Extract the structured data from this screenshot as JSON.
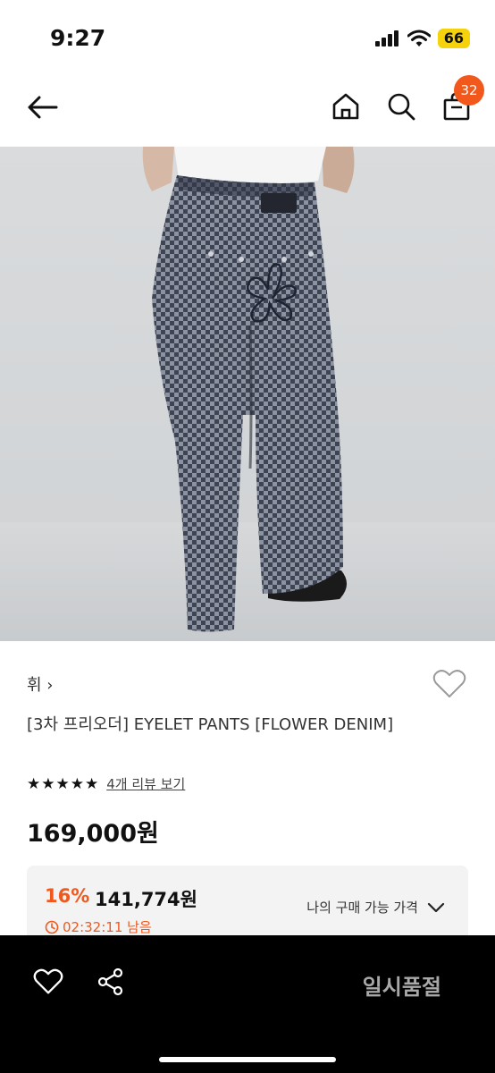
{
  "status_bar": {
    "time": "9:27",
    "battery": "66",
    "icons": [
      "signal-icon",
      "wifi-icon",
      "battery-icon"
    ]
  },
  "header": {
    "back_icon": "arrow-left-icon",
    "home_icon": "home-icon",
    "search_icon": "search-icon",
    "cart_icon": "bag-icon",
    "cart_count": "32"
  },
  "product": {
    "image": "gray checkered wide-leg pants, back view",
    "brand": "휘",
    "title": "[3차 프리오더] EYELET PANTS [FLOWER DENIM]",
    "rating_stars": "★★★★★",
    "rating_value": 5,
    "review_link": "4개 리뷰 보기",
    "price": "169,000원"
  },
  "discount": {
    "rate": "16%",
    "price": "141,774원",
    "timer": "02:32:11 남음",
    "my_price_label": "나의 구매 가능 가격"
  },
  "bottom_bar": {
    "like_icon": "heart-outline-icon",
    "share_icon": "share-icon",
    "action_label": "일시품절"
  },
  "colors": {
    "accent": "#f2581b",
    "battery": "#f5d20b",
    "bottom_bar": "#000000",
    "disabled_text": "#a8a8a8"
  }
}
